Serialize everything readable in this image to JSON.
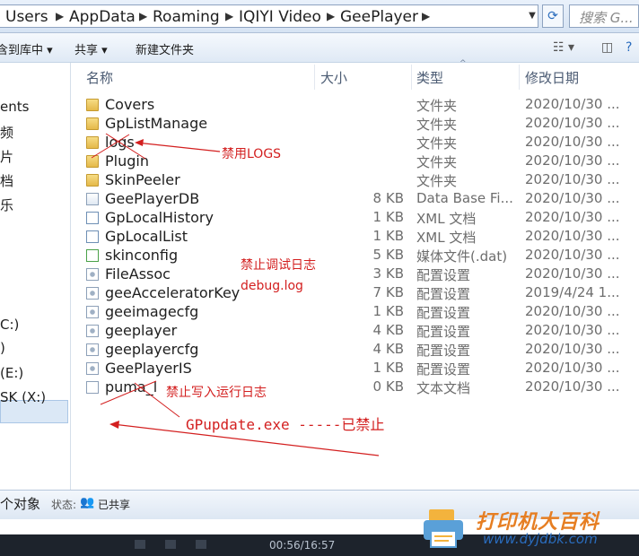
{
  "address_bar": {
    "crumbs": [
      "Users",
      "AppData",
      "Roaming",
      "IQIYI Video",
      "GeePlayer"
    ],
    "search_placeholder": "搜索 G..."
  },
  "toolbar": {
    "include_label": "含到库中 ▾",
    "share_label": "共享 ▾",
    "new_folder_label": "新建文件夹"
  },
  "nav": {
    "items": [
      "ents",
      "频",
      "片",
      "档",
      "乐",
      "C:)",
      ")",
      "(E:)",
      "SK (X:)"
    ]
  },
  "columns": {
    "name": "名称",
    "size": "大小",
    "type": "类型",
    "date": "修改日期"
  },
  "files": [
    {
      "name": "Covers",
      "size": "",
      "type": "文件夹",
      "date": "2020/10/30 ...",
      "icon": "folder"
    },
    {
      "name": "GpListManage",
      "size": "",
      "type": "文件夹",
      "date": "2020/10/30 ...",
      "icon": "folder"
    },
    {
      "name": "logs",
      "size": "",
      "type": "文件夹",
      "date": "2020/10/30 ...",
      "icon": "folder"
    },
    {
      "name": "Plugin",
      "size": "",
      "type": "文件夹",
      "date": "2020/10/30 ...",
      "icon": "folder"
    },
    {
      "name": "SkinPeeler",
      "size": "",
      "type": "文件夹",
      "date": "2020/10/30 ...",
      "icon": "folder"
    },
    {
      "name": "GeePlayerDB",
      "size": "8 KB",
      "type": "Data Base Fi...",
      "date": "2020/10/30 ...",
      "icon": "db"
    },
    {
      "name": "GpLocalHistory",
      "size": "1 KB",
      "type": "XML 文档",
      "date": "2020/10/30 ...",
      "icon": "xml"
    },
    {
      "name": "GpLocalList",
      "size": "1 KB",
      "type": "XML 文档",
      "date": "2020/10/30 ...",
      "icon": "xml"
    },
    {
      "name": "skinconfig",
      "size": "5 KB",
      "type": "媒体文件(.dat)",
      "date": "2020/10/30 ...",
      "icon": "media"
    },
    {
      "name": "FileAssoc",
      "size": "3 KB",
      "type": "配置设置",
      "date": "2020/10/30 ...",
      "icon": "cfg"
    },
    {
      "name": "geeAcceleratorKey",
      "size": "7 KB",
      "type": "配置设置",
      "date": "2019/4/24 1...",
      "icon": "cfg"
    },
    {
      "name": "geeimagecfg",
      "size": "1 KB",
      "type": "配置设置",
      "date": "2020/10/30 ...",
      "icon": "cfg"
    },
    {
      "name": "geeplayer",
      "size": "4 KB",
      "type": "配置设置",
      "date": "2020/10/30 ...",
      "icon": "cfg"
    },
    {
      "name": "geeplayercfg",
      "size": "4 KB",
      "type": "配置设置",
      "date": "2020/10/30 ...",
      "icon": "cfg"
    },
    {
      "name": "GeePlayerIS",
      "size": "1 KB",
      "type": "配置设置",
      "date": "2020/10/30 ...",
      "icon": "cfg"
    },
    {
      "name": "puma_l",
      "size": "0 KB",
      "type": "文本文档",
      "date": "2020/10/30 ...",
      "icon": "txt"
    }
  ],
  "annotations": {
    "disable_logs": "禁用LOGS",
    "disable_debug_log": "禁止调试日志",
    "debug_log_file": "debug.log",
    "disable_run_log": "禁止写入运行日志",
    "gpupdate": "GPupdate.exe -----已禁止",
    "color": "#d31f1f"
  },
  "status": {
    "count_label": "个对象",
    "state_label": "状态:",
    "state_value": "已共享"
  },
  "taskbar": {
    "time_text": "00:56/16:57"
  },
  "watermark": {
    "title": "打印机大百科",
    "url": "www.dyjdbk.com"
  }
}
